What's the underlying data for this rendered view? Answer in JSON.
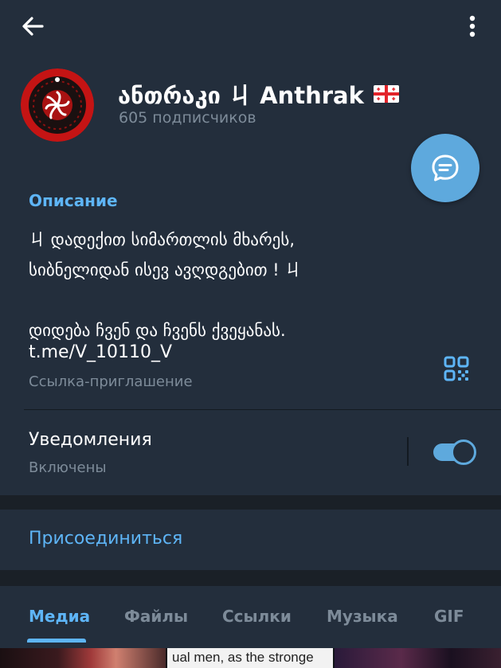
{
  "channel": {
    "name": "ანთრაკი ㄐ Anthrak",
    "flag": "🇬🇪",
    "subscribers": "605 подписчиков"
  },
  "info": {
    "section_label": "Описание",
    "description": "ㄐ დადექით სიმართლის მხარეს,\nსიბნელიდან ისევ ავღდგებით ! ㄐ\n\nდიდება ჩვენ და ჩვენს ქვეყანას.",
    "link": "t.me/V_10110_V",
    "link_label": "Ссылка-приглашение"
  },
  "notifications": {
    "title": "Уведомления",
    "status": "Включены",
    "enabled": true
  },
  "join": {
    "label": "Присоединиться"
  },
  "tabs": [
    {
      "label": "Медиа",
      "active": true
    },
    {
      "label": "Файлы",
      "active": false
    },
    {
      "label": "Ссылки",
      "active": false
    },
    {
      "label": "Музыка",
      "active": false
    },
    {
      "label": "GIF",
      "active": false
    }
  ],
  "media_strip": {
    "caption": "ual men, as the stronge"
  },
  "colors": {
    "accent": "#5eb5f7",
    "fab": "#5ea9dd",
    "card_bg": "#232e3c",
    "page_bg": "#1a2027",
    "secondary_text": "#7d8b99"
  },
  "icons": {
    "back": "arrow-left-icon",
    "menu": "more-vertical-icon",
    "fab": "message-icon",
    "qr": "qr-code-icon"
  }
}
